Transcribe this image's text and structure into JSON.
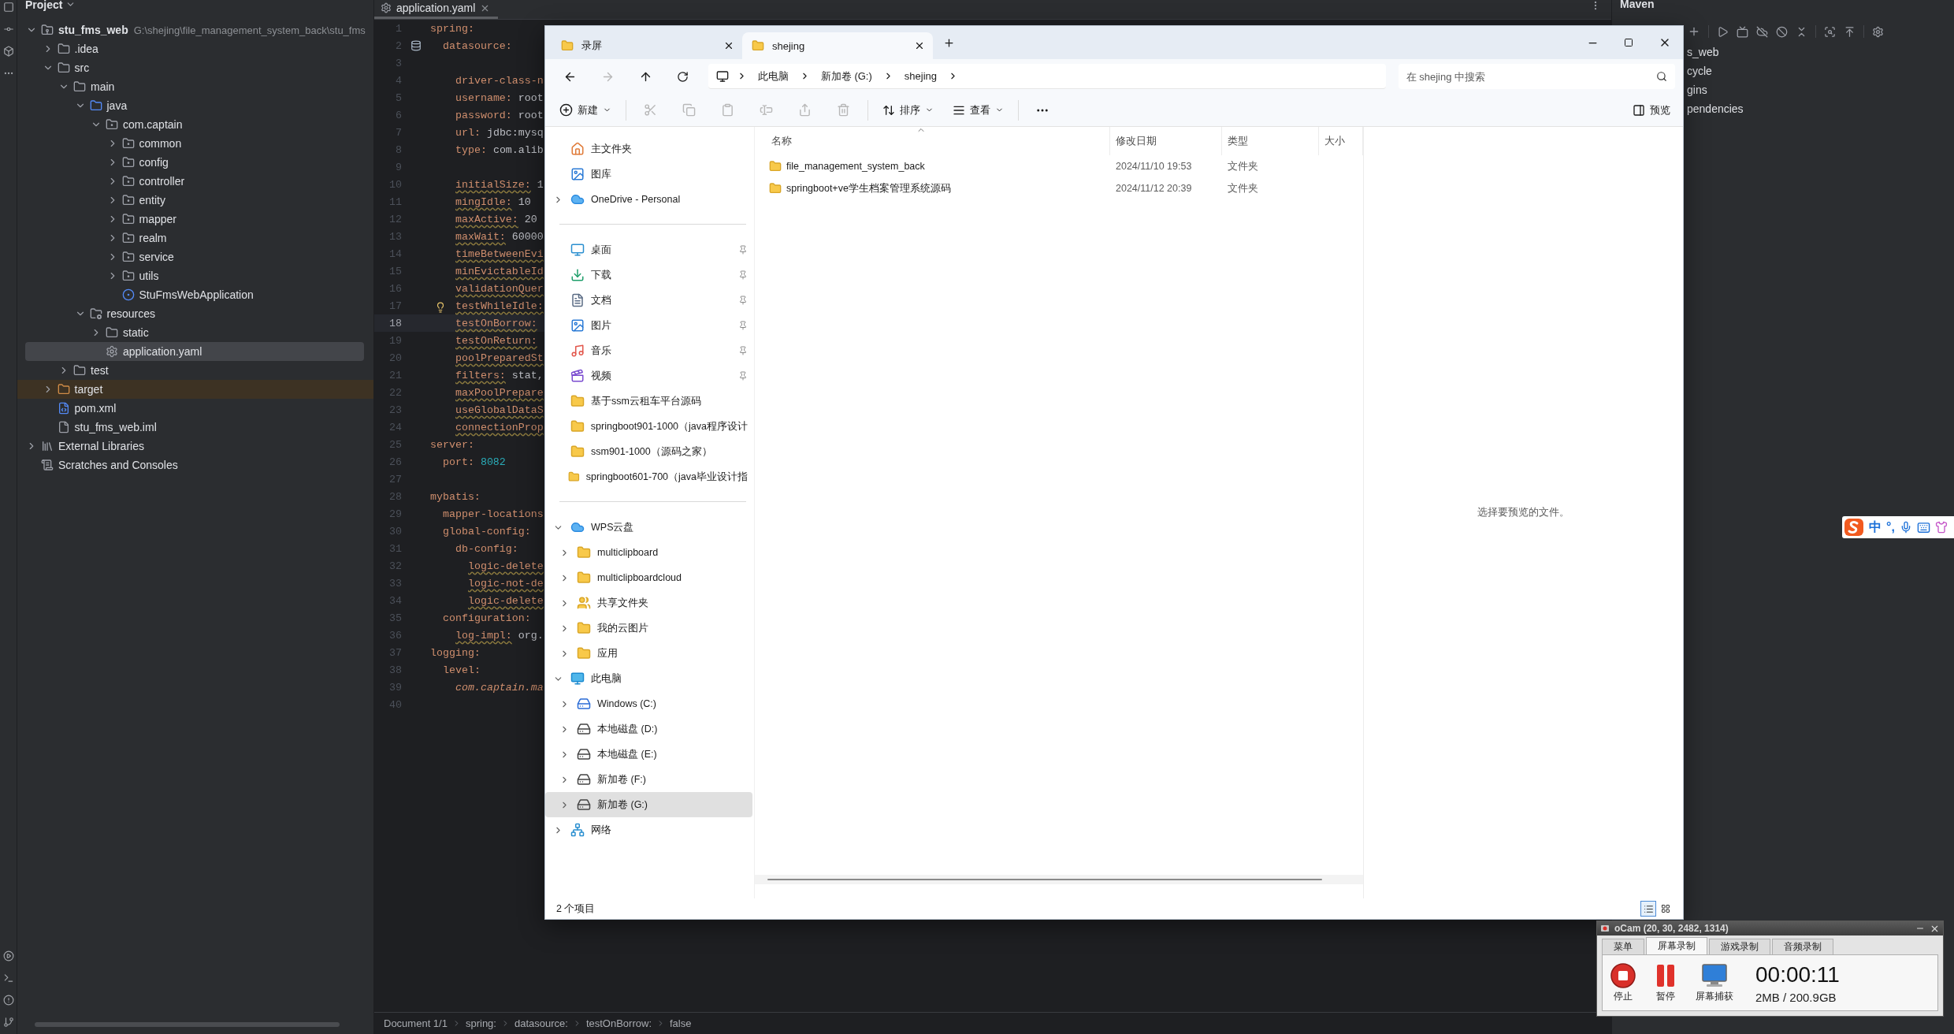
{
  "ide": {
    "project_panel": {
      "title": "Project",
      "tree": [
        {
          "label": "stu_fms_web",
          "hint": "G:\\shejing\\file_management_system_back\\stu_fms",
          "kind": "module",
          "expanded": true,
          "selected": false,
          "children": [
            {
              "label": ".idea",
              "kind": "folder",
              "expanded": false,
              "selected": false
            },
            {
              "label": "src",
              "kind": "folder",
              "expanded": true,
              "selected": false,
              "children": [
                {
                  "label": "main",
                  "kind": "folder",
                  "expanded": true,
                  "selected": false,
                  "children": [
                    {
                      "label": "java",
                      "kind": "source",
                      "expanded": true,
                      "selected": false,
                      "children": [
                        {
                          "label": "com.captain",
                          "kind": "package",
                          "expanded": true,
                          "selected": false,
                          "children": [
                            {
                              "label": "common",
                              "kind": "package",
                              "expanded": false,
                              "selected": false
                            },
                            {
                              "label": "config",
                              "kind": "package",
                              "expanded": false,
                              "selected": false
                            },
                            {
                              "label": "controller",
                              "kind": "package",
                              "expanded": false,
                              "selected": false
                            },
                            {
                              "label": "entity",
                              "kind": "package",
                              "expanded": false,
                              "selected": false
                            },
                            {
                              "label": "mapper",
                              "kind": "package",
                              "expanded": false,
                              "selected": false
                            },
                            {
                              "label": "realm",
                              "kind": "package",
                              "expanded": false,
                              "selected": false
                            },
                            {
                              "label": "service",
                              "kind": "package",
                              "expanded": false,
                              "selected": false
                            },
                            {
                              "label": "utils",
                              "kind": "package",
                              "expanded": false,
                              "selected": false
                            },
                            {
                              "label": "StuFmsWebApplication",
                              "kind": "app",
                              "selected": false
                            }
                          ]
                        }
                      ]
                    },
                    {
                      "label": "resources",
                      "kind": "resources",
                      "expanded": true,
                      "selected": false,
                      "children": [
                        {
                          "label": "static",
                          "kind": "folder",
                          "expanded": false,
                          "selected": false
                        },
                        {
                          "label": "application.yaml",
                          "kind": "yaml",
                          "selected": true
                        }
                      ]
                    }
                  ]
                },
                {
                  "label": "test",
                  "kind": "folder",
                  "expanded": false,
                  "selected": false
                }
              ]
            },
            {
              "label": "target",
              "kind": "excluded",
              "expanded": false,
              "selected": false
            },
            {
              "label": "pom.xml",
              "kind": "maven",
              "selected": false
            },
            {
              "label": "stu_fms_web.iml",
              "kind": "iml",
              "selected": false
            }
          ]
        },
        {
          "label": "External Libraries",
          "kind": "library",
          "expanded": false,
          "selected": false
        },
        {
          "label": "Scratches and Consoles",
          "kind": "scratch",
          "selected": false
        }
      ]
    },
    "editor": {
      "tabs": [
        {
          "label": "application.yaml",
          "selected": true
        }
      ],
      "lines": [
        {
          "n": "1",
          "kind": "key",
          "key": "spring:",
          "current": false,
          "children": [
            {
              "n": "2",
              "kind": "key",
              "key": "datasource:",
              "gutter_icon": {
                "kind": "database"
              },
              "current": false,
              "children": [
                {
                  "n": "3",
                  "kind": "blank",
                  "current": false
                },
                {
                  "n": "4",
                  "kind": "key",
                  "key": "driver-class-n",
                  "current": false
                },
                {
                  "n": "5",
                  "kind": "key",
                  "key": "username:",
                  "value": {
                    "text": "root",
                    "kind": "text"
                  },
                  "current": false
                },
                {
                  "n": "6",
                  "kind": "key",
                  "key": "password:",
                  "value": {
                    "text": "root",
                    "kind": "text"
                  },
                  "current": false
                },
                {
                  "n": "7",
                  "kind": "key",
                  "key": "url:",
                  "value": {
                    "text": "jdbc:mysq",
                    "kind": "text"
                  },
                  "current": false
                },
                {
                  "n": "8",
                  "kind": "key",
                  "key": "type:",
                  "value": {
                    "text": "com.alib",
                    "kind": "text"
                  },
                  "current": false
                },
                {
                  "n": "9",
                  "kind": "blank",
                  "current": false
                },
                {
                  "n": "10",
                  "kind": "unknown_key",
                  "key": "initialSize:",
                  "value": {
                    "text": "1",
                    "kind": "text"
                  },
                  "current": false
                },
                {
                  "n": "11",
                  "kind": "unknown_key",
                  "key": "mingIdle:",
                  "value": {
                    "text": "10",
                    "kind": "text"
                  },
                  "current": false
                },
                {
                  "n": "12",
                  "kind": "unknown_key",
                  "key": "maxActive:",
                  "value": {
                    "text": "20",
                    "kind": "text"
                  },
                  "current": false
                },
                {
                  "n": "13",
                  "kind": "unknown_key",
                  "key": "maxWait:",
                  "value": {
                    "text": "60000",
                    "kind": "text"
                  },
                  "current": false
                },
                {
                  "n": "14",
                  "kind": "unknown_key",
                  "key": "timeBetweenEvi",
                  "current": false
                },
                {
                  "n": "15",
                  "kind": "unknown_key",
                  "key": "minEvictableId",
                  "current": false
                },
                {
                  "n": "16",
                  "kind": "unknown_key",
                  "key": "validationQuer",
                  "current": false
                },
                {
                  "n": "17",
                  "kind": "unknown_key",
                  "key": "testWhileIdle:",
                  "gutter_icon": {
                    "kind": "bulb"
                  },
                  "current": false
                },
                {
                  "n": "18",
                  "kind": "unknown_key",
                  "key": "testOnBorrow:",
                  "current": true
                },
                {
                  "n": "19",
                  "kind": "unknown_key",
                  "key": "testOnReturn:",
                  "current": false
                },
                {
                  "n": "20",
                  "kind": "unknown_key",
                  "key": "poolPreparedSt",
                  "current": false
                },
                {
                  "n": "21",
                  "kind": "unknown_key",
                  "key": "filters:",
                  "value": {
                    "text": "stat,",
                    "kind": "text"
                  },
                  "current": false
                },
                {
                  "n": "22",
                  "kind": "unknown_key",
                  "key": "maxPoolPrepare",
                  "current": false
                },
                {
                  "n": "23",
                  "kind": "unknown_key",
                  "key": "useGlobalDataS",
                  "current": false
                },
                {
                  "n": "24",
                  "kind": "unknown_key",
                  "key": "connectionProp",
                  "current": false
                }
              ]
            }
          ]
        },
        {
          "n": "25",
          "kind": "key",
          "key": "server:",
          "current": false,
          "children": [
            {
              "n": "26",
              "kind": "key",
              "key": "port:",
              "value": {
                "text": "8082",
                "kind": "number"
              },
              "current": false
            }
          ]
        },
        {
          "n": "27",
          "kind": "blank",
          "current": false
        },
        {
          "n": "28",
          "kind": "key",
          "key": "mybatis:",
          "current": false,
          "children": [
            {
              "n": "29",
              "kind": "key",
              "key": "mapper-locations",
              "current": false
            },
            {
              "n": "30",
              "kind": "key",
              "key": "global-config:",
              "current": false,
              "children": [
                {
                  "n": "31",
                  "kind": "key",
                  "key": "db-config:",
                  "current": false,
                  "children": [
                    {
                      "n": "32",
                      "kind": "unknown_key",
                      "key": "logic-delete",
                      "current": false
                    },
                    {
                      "n": "33",
                      "kind": "unknown_key",
                      "key": "logic-not-de",
                      "current": false
                    },
                    {
                      "n": "34",
                      "kind": "unknown_key",
                      "key": "logic-delete",
                      "current": false
                    }
                  ]
                }
              ]
            },
            {
              "n": "35",
              "kind": "key",
              "key": "configuration:",
              "current": false,
              "children": [
                {
                  "n": "36",
                  "kind": "unknown_key",
                  "key": "log-impl:",
                  "value": {
                    "text": "org.",
                    "kind": "text"
                  },
                  "current": false
                }
              ]
            }
          ]
        },
        {
          "n": "37",
          "kind": "key",
          "key": "logging:",
          "current": false,
          "children": [
            {
              "n": "38",
              "kind": "key",
              "key": "level:",
              "current": false,
              "children": [
                {
                  "n": "39",
                  "kind": "path_key",
                  "key": "com.captain.ma",
                  "current": false
                }
              ]
            }
          ]
        },
        {
          "n": "40",
          "kind": "blank",
          "current": false
        }
      ],
      "breadcrumbs": [
        "Document 1/1",
        "spring:",
        "datasource:",
        "testOnBorrow:",
        "false"
      ]
    },
    "maven": {
      "title": "Maven",
      "items": [
        "s_web",
        "cycle",
        "gins",
        "pendencies"
      ]
    }
  },
  "explorer": {
    "tabs": [
      {
        "label": "录屏",
        "selected": false
      },
      {
        "label": "shejing",
        "selected": true
      }
    ],
    "nav_buttons": [
      {
        "kind": "back",
        "disabled": false
      },
      {
        "kind": "forward",
        "disabled": true
      },
      {
        "kind": "up",
        "disabled": false
      },
      {
        "kind": "refresh",
        "disabled": false
      }
    ],
    "breadcrumb": [
      "此电脑",
      "新加卷 (G:)",
      "shejing"
    ],
    "search": {
      "placeholder": "在 shejing 中搜索"
    },
    "toolbar": {
      "new": "新建",
      "actions": [
        {
          "kind": "cut",
          "disabled": true
        },
        {
          "kind": "copy",
          "disabled": true
        },
        {
          "kind": "paste",
          "disabled": true
        },
        {
          "kind": "rename",
          "disabled": true
        },
        {
          "kind": "share",
          "disabled": true
        },
        {
          "kind": "delete",
          "disabled": true
        }
      ],
      "sort": "排序",
      "view": "查看",
      "preview": "预览"
    },
    "nav_sections": [
      {
        "items": [
          {
            "label": "主文件夹",
            "kind": "home",
            "selected": false
          },
          {
            "label": "图库",
            "kind": "gallery",
            "selected": false
          },
          {
            "label": "OneDrive - Personal",
            "kind": "cloud",
            "expanded": false,
            "selected": false
          }
        ]
      },
      {
        "items": [
          {
            "label": "桌面",
            "kind": "desktop",
            "pinned": true,
            "selected": false
          },
          {
            "label": "下载",
            "kind": "download",
            "pinned": true,
            "selected": false
          },
          {
            "label": "文档",
            "kind": "document",
            "pinned": true,
            "selected": false
          },
          {
            "label": "图片",
            "kind": "pictures",
            "pinned": true,
            "selected": false
          },
          {
            "label": "音乐",
            "kind": "music",
            "pinned": true,
            "selected": false
          },
          {
            "label": "视频",
            "kind": "video",
            "pinned": true,
            "selected": false
          },
          {
            "label": "基于ssm云租车平台源码",
            "kind": "folder",
            "pinned": false,
            "selected": false
          },
          {
            "label": "springboot901-1000（java程序设计",
            "kind": "folder",
            "pinned": false,
            "selected": false
          },
          {
            "label": "ssm901-1000（源码之家）",
            "kind": "folder",
            "pinned": false,
            "selected": false
          },
          {
            "label": "springboot601-700（java毕业设计指",
            "kind": "folder",
            "pinned": false,
            "selected": false
          }
        ]
      },
      {
        "items": [
          {
            "label": "WPS云盘",
            "kind": "cloud",
            "expanded": true,
            "selected": false,
            "children": [
              {
                "label": "multiclipboard",
                "kind": "folder",
                "expanded": false,
                "selected": false
              },
              {
                "label": "multiclipboardcloud",
                "kind": "folder",
                "expanded": false,
                "selected": false
              },
              {
                "label": "共享文件夹",
                "kind": "shared",
                "expanded": false,
                "selected": false
              },
              {
                "label": "我的云图片",
                "kind": "folder",
                "expanded": false,
                "selected": false
              },
              {
                "label": "应用",
                "kind": "folder",
                "expanded": false,
                "selected": false
              }
            ]
          },
          {
            "label": "此电脑",
            "kind": "pc",
            "expanded": true,
            "selected": false,
            "children": [
              {
                "label": "Windows (C:)",
                "kind": "system_drive",
                "expanded": false,
                "selected": false
              },
              {
                "label": "本地磁盘 (D:)",
                "kind": "drive",
                "expanded": false,
                "selected": false
              },
              {
                "label": "本地磁盘 (E:)",
                "kind": "drive",
                "expanded": false,
                "selected": false
              },
              {
                "label": "新加卷 (F:)",
                "kind": "drive",
                "expanded": false,
                "selected": false
              },
              {
                "label": "新加卷 (G:)",
                "kind": "drive",
                "expanded": false,
                "selected": true
              }
            ]
          },
          {
            "label": "网络",
            "kind": "network",
            "expanded": false,
            "selected": false
          }
        ]
      }
    ],
    "columns": [
      "名称",
      "修改日期",
      "类型",
      "大小"
    ],
    "rows": [
      {
        "name": "file_management_system_back",
        "date": "2024/11/10 19:53",
        "type": "文件夹",
        "selected": false
      },
      {
        "name": "springboot+ve学生档案管理系统源码",
        "date": "2024/11/12 20:39",
        "type": "文件夹",
        "selected": false
      }
    ],
    "preview_hint": "选择要预览的文件。",
    "status": "2 个项目",
    "views": [
      {
        "kind": "details",
        "selected": true
      },
      {
        "kind": "tiles",
        "selected": false
      }
    ]
  },
  "ime": {
    "mode": "中",
    "punct": "°,"
  },
  "ocam": {
    "title": "oCam (20, 30, 2482, 1314)",
    "tabs": [
      {
        "label": "菜单",
        "selected": false
      },
      {
        "label": "屏幕录制",
        "selected": true
      },
      {
        "label": "游戏录制",
        "selected": false
      },
      {
        "label": "音频录制",
        "selected": false
      }
    ],
    "buttons": [
      {
        "kind": "stop",
        "label": "停止"
      },
      {
        "kind": "pause",
        "label": "暂停"
      },
      {
        "kind": "capture",
        "label": "屏幕捕获"
      }
    ],
    "time": "00:00:11",
    "size": "2MB / 200.9GB"
  }
}
